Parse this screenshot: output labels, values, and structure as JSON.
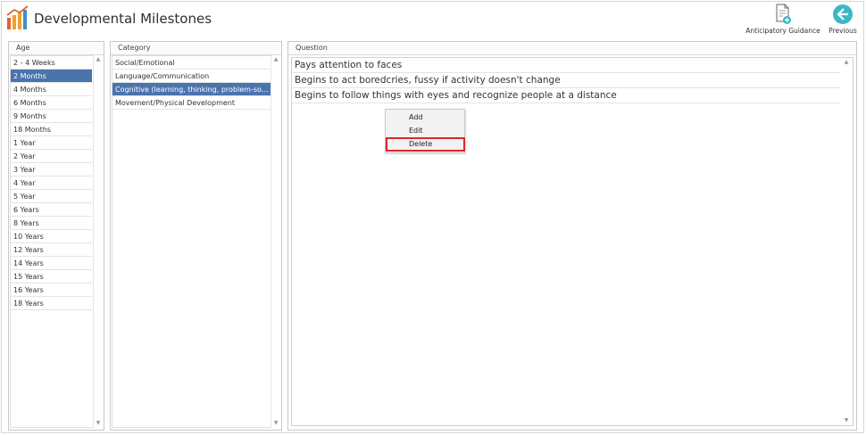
{
  "app": {
    "title": "Developmental Milestones"
  },
  "toolbar": {
    "anticipatory_label": "Anticipatory Guidance",
    "previous_label": "Previous"
  },
  "age_panel": {
    "header": "Age",
    "items": [
      "2 - 4 Weeks",
      "2 Months",
      "4 Months",
      "6 Months",
      "9 Months",
      "18 Months",
      "1 Year",
      "2 Year",
      "3 Year",
      "4 Year",
      "5 Year",
      "6 Years",
      "8 Years",
      "10 Years",
      "12 Years",
      "14 Years",
      "15 Years",
      "16 Years",
      "18 Years"
    ],
    "selected": "2 Months"
  },
  "category_panel": {
    "header": "Category",
    "items": [
      "Social/Emotional",
      "Language/Communication",
      "Cognitive (learning, thinking, problem-solvi...",
      "Movement/Physical Development"
    ],
    "selected": "Cognitive (learning, thinking, problem-solvi..."
  },
  "question_panel": {
    "header": "Question",
    "items": [
      "Pays attention to faces",
      "Begins to act boredcries, fussy if activity doesn't change",
      "Begins to follow things with eyes and recognize people at a distance"
    ]
  },
  "context_menu": {
    "items": [
      "Add",
      "Edit",
      "Delete"
    ],
    "highlighted": "Delete"
  },
  "colors": {
    "selection": "#4a74ad",
    "previous_icon": "#3bb8c4",
    "highlight": "#e0252e"
  }
}
